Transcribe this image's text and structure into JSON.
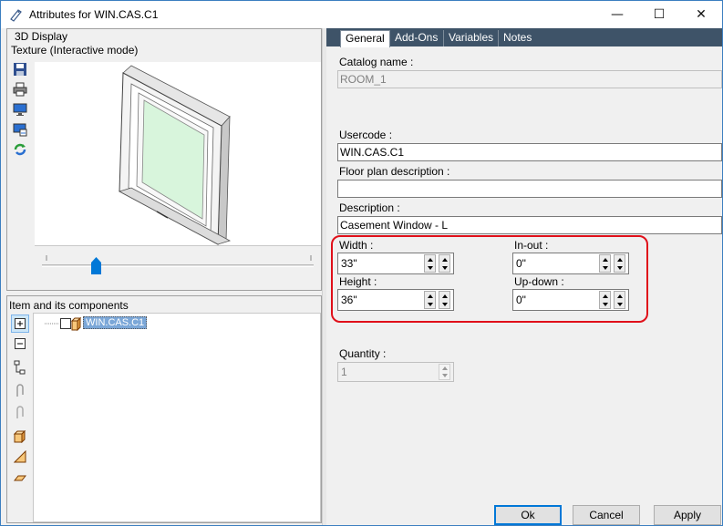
{
  "window": {
    "title": "Attributes for WIN.CAS.C1",
    "minimize_glyph": "—",
    "maximize_glyph": "☐",
    "close_glyph": "✕"
  },
  "display_panel": {
    "heading": "3D Display",
    "mode_label": "Texture (Interactive mode)",
    "tools": [
      "save-icon",
      "print-icon",
      "monitor-icon",
      "screen-export-icon",
      "refresh-icon"
    ],
    "slider_level": 0.2
  },
  "components_panel": {
    "heading": "Item and its components",
    "tree_item": "WIN.CAS.C1",
    "tools": [
      "expand-icon",
      "collapse-icon",
      "hierarchy-icon",
      "clip-icon",
      "clip-disabled-icon",
      "box-icon",
      "wedge-icon",
      "plane-icon"
    ]
  },
  "tabs": [
    "General",
    "Add-Ons",
    "Variables",
    "Notes"
  ],
  "general": {
    "catalog_name_label": "Catalog name :",
    "catalog_name_value": "ROOM_1",
    "usercode_label": "Usercode :",
    "usercode_value": "WIN.CAS.C1",
    "floor_plan_label": "Floor plan description :",
    "floor_plan_value": "",
    "description_label": "Description :",
    "description_value": "Casement Window - L",
    "width_label": "Width :",
    "width_value": "33\"",
    "height_label": "Height :",
    "height_value": "36\"",
    "inout_label": "In-out :",
    "inout_value": "0\"",
    "updown_label": "Up-down :",
    "updown_value": "0\"",
    "quantity_label": "Quantity :",
    "quantity_value": "1"
  },
  "buttons": {
    "ok": "Ok",
    "cancel": "Cancel",
    "apply": "Apply"
  },
  "colors": {
    "tab_bar": "#3e5368",
    "highlight": "#e0101a",
    "glass": "#d8f5dc"
  }
}
